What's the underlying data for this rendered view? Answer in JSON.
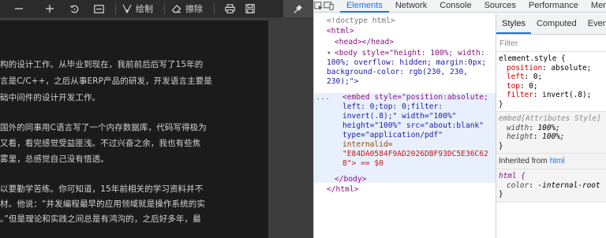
{
  "viewer": {
    "toolbar": {
      "draw_label": "绘制",
      "erase_label": "擦除"
    },
    "lines": [
      "构的设计工作。从毕业到现在，我前前后后写了15年的",
      "言是C/C++，之后从事ERP产品的研发，开发语言主要是",
      "础中间件的设计开发工作。",
      "国外的同事用C语言写了一个内存数据库，代码写得极为",
      "又看，看完感觉受益匪浅。不过兴奋之余，我也有些焦",
      "雾里，总感觉自己没有悟透。",
      "以要勤学苦练。你可知道，15年前相关的学习资料并不",
      "材。他说：“并发编程最早的应用领域就是操作系统的实",
      "。”但是理论和实践之间总是有鸿沟的，之后好多年，最"
    ]
  },
  "devtools": {
    "tabs": [
      "Elements",
      "Network",
      "Console",
      "Sources",
      "Performance",
      "Memo"
    ],
    "active_tab": "Elements",
    "elements": {
      "doctype": "<!doctype html>",
      "html_open": "<html>",
      "head": "<head></head>",
      "body_open": "<body style=\"height: 100%; width:",
      "body_open_2": "100%; overflow: hidden; margin:0px;",
      "body_open_3": "background-color: rgb(230, 230,",
      "body_open_4": "230);\">",
      "embed_1": "<embed style=\"position:absolute;",
      "embed_2": "left: 0;top: 0;filter:",
      "embed_3": "invert(.8);\" width=\"100%\"",
      "embed_4": "height=\"100%\" src=\"about:blank\"",
      "embed_5": "type=\"application/pdf\"",
      "embed_6": "internalid=",
      "embed_7": "\"E84DA0584F9AD2026DBF93DC5E36C62",
      "embed_8": "8\"> == $0",
      "body_close": "</body>",
      "html_close": "</html>",
      "dots": "..."
    },
    "styles": {
      "tabs": [
        "Styles",
        "Computed",
        "Event"
      ],
      "active_tab": "Styles",
      "filter_placeholder": "Filter",
      "element_style_selector": "element.style {",
      "element_style_props": [
        {
          "name": "position",
          "value": "absolute;"
        },
        {
          "name": "left",
          "value": "0;"
        },
        {
          "name": "top",
          "value": "0;"
        },
        {
          "name": "filter",
          "value": "invert(.8);"
        }
      ],
      "close_brace": "}",
      "embed_attr_selector": "embed[Attributes Style]",
      "embed_attr_props": [
        {
          "name": "width",
          "value": "100%;"
        },
        {
          "name": "height",
          "value": "100%;"
        }
      ],
      "inherited_label": "Inherited from",
      "inherited_link": "html",
      "html_selector": "html {",
      "html_props": [
        {
          "name": "color",
          "value": "-internal-root"
        }
      ]
    }
  }
}
